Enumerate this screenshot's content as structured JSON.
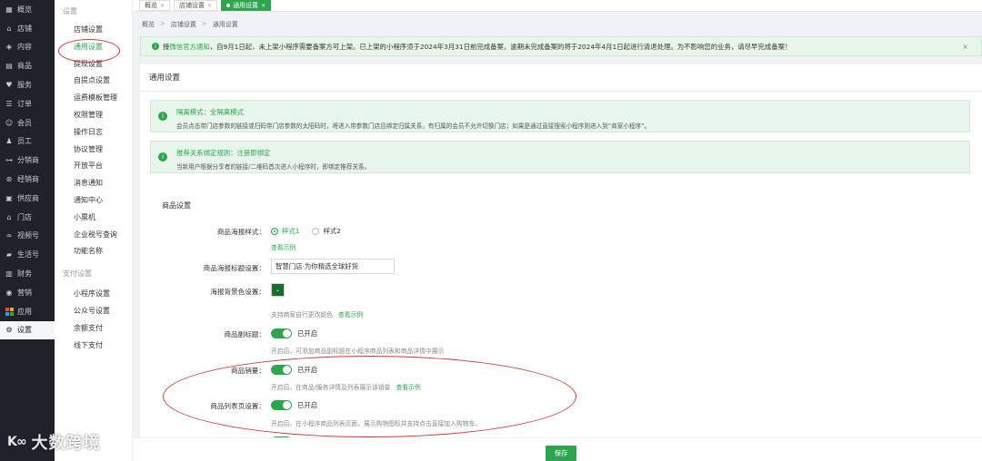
{
  "nav": {
    "items": [
      {
        "label": "概览",
        "icon": "chart-icon"
      },
      {
        "label": "店铺",
        "icon": "store-icon"
      },
      {
        "label": "内容",
        "icon": "content-icon"
      },
      {
        "label": "商品",
        "icon": "goods-icon"
      },
      {
        "label": "服务",
        "icon": "heart-icon"
      },
      {
        "label": "订单",
        "icon": "order-icon"
      },
      {
        "label": "会员",
        "icon": "member-icon"
      },
      {
        "label": "员工",
        "icon": "staff-icon"
      },
      {
        "label": "分销商",
        "icon": "distributor-icon"
      },
      {
        "label": "经销商",
        "icon": "dealer-icon"
      },
      {
        "label": "供应商",
        "icon": "supplier-icon"
      },
      {
        "label": "门店",
        "icon": "shop-icon"
      },
      {
        "label": "视频号",
        "icon": "video-icon"
      },
      {
        "label": "生活号",
        "icon": "life-icon"
      },
      {
        "label": "财务",
        "icon": "finance-icon"
      },
      {
        "label": "营销",
        "icon": "marketing-icon"
      },
      {
        "label": "应用",
        "icon": "apps-icon"
      },
      {
        "label": "设置",
        "icon": "settings-icon"
      }
    ],
    "active_index": 17,
    "app_grid_colors": [
      "#e94b3c",
      "#f5a623",
      "#4a90e2",
      "#2ea44f"
    ]
  },
  "submenu": {
    "group1": "设置",
    "items1": [
      "店铺设置",
      "通用设置",
      "提现设置",
      "自提点设置",
      "运费模板管理",
      "权限管理",
      "操作日志",
      "协议管理",
      "开放平台",
      "消息通知",
      "通知中心",
      "小票机",
      "企业税号查询",
      "功能名称"
    ],
    "active": "通用设置",
    "group2": "支付设置",
    "items2": [
      "小程序设置",
      "公众号设置",
      "余额支付",
      "线下支付"
    ]
  },
  "tabs": [
    {
      "label": "概览",
      "close": "×"
    },
    {
      "label": "店铺设置",
      "close": "×"
    },
    {
      "label": "通用设置",
      "close": "×"
    }
  ],
  "breadcrumb": [
    "概览",
    "店铺设置",
    "通用设置"
  ],
  "breadcrumb_sep": ">",
  "notice": {
    "prefix": "接",
    "link": "微信官方通知",
    "text": "，自9月1日起，未上架小程序需要备案方可上架。已上架的小程序须于2024年3月31日前完成备案，逾期未完成备案的将于2024年4月1日起进行清退处理。为不影响您的业务，请尽早完成备案！",
    "close": "×"
  },
  "page_title": "通用设置",
  "tip1": {
    "title": "隔离模式：全隔离模式",
    "desc": "会员点击带门店参数的链接或扫码带门店参数的太阳码时，将进入带参数门店且绑定归属关系，有归属的会员不允许切换门店；如果是通过直接搜索小程序则进入到“商家小程序”。"
  },
  "tip2": {
    "title": "推荐关系绑定规则：注册即绑定",
    "desc": "当新用户根据分享者的链接/二维码首次进入小程序时，即绑定推荐关系。"
  },
  "goods_section": "商品设置",
  "poster_style": {
    "label": "商品海报样式：",
    "opt1": "样式1",
    "opt2": "样式2",
    "example": "查看示例"
  },
  "poster_title": {
    "label": "商品海报标题设置：",
    "value": "智慧门店·为你精选全球好货"
  },
  "poster_bg": {
    "label": "海报背景色设置：",
    "color": "#1b6b2f",
    "hint": "支持商家自行更改颜色",
    "example": "查看示例"
  },
  "subtitle": {
    "label": "商品副标题：",
    "state": "已开启",
    "hint": "开启后，可添加商品副标题在小程序商品列表和商品详情中展示"
  },
  "sales": {
    "label": "商品销量：",
    "state": "已开启",
    "hint": "开启后，在商品/服务详情及列表展示该销量",
    "example": "查看示例"
  },
  "list_page": {
    "label": "商品列表页设置：",
    "state": "已开启",
    "hint": "开启后，在小程序商品列表页面，展示购物图标并支持点击直接加入购物车。"
  },
  "save": "保存",
  "watermark": {
    "logo": "K∞",
    "text": "大数跨境"
  },
  "accent": "#2ea44f",
  "annotation_color": "#d03a3a"
}
